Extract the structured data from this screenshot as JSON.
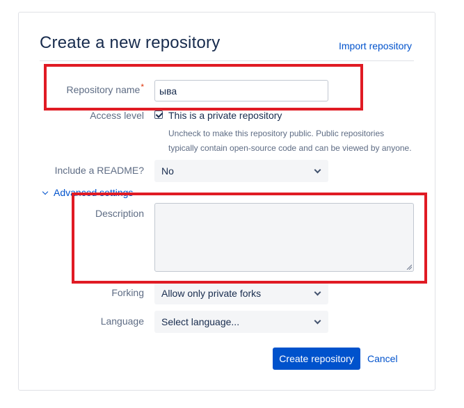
{
  "header": {
    "title": "Create a new repository",
    "import_link": "Import repository"
  },
  "form": {
    "repo_name": {
      "label": "Repository name",
      "required_mark": "*",
      "value": "ыва"
    },
    "access": {
      "label": "Access level",
      "checkbox_label": "This is a private repository",
      "checked": true,
      "help_line1": "Uncheck to make this repository public. Public repositories",
      "help_line2": "typically contain open-source code and can be viewed by anyone."
    },
    "readme": {
      "label": "Include a README?",
      "value": "No"
    },
    "advanced": {
      "label": "Advanced settings"
    },
    "description": {
      "label": "Description",
      "value": ""
    },
    "forking": {
      "label": "Forking",
      "value": "Allow only private forks"
    },
    "language": {
      "label": "Language",
      "value": "Select language..."
    }
  },
  "actions": {
    "create": "Create repository",
    "cancel": "Cancel"
  },
  "colors": {
    "primary": "#0052cc",
    "annotation": "#e01b24",
    "required": "#de350b"
  }
}
